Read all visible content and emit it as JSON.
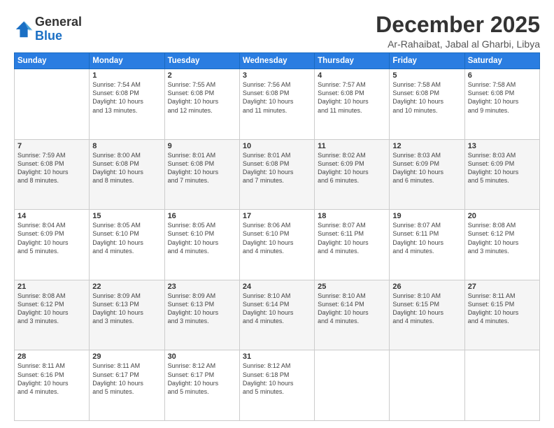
{
  "logo": {
    "general": "General",
    "blue": "Blue"
  },
  "title": "December 2025",
  "subtitle": "Ar-Rahaibat, Jabal al Gharbi, Libya",
  "weekdays": [
    "Sunday",
    "Monday",
    "Tuesday",
    "Wednesday",
    "Thursday",
    "Friday",
    "Saturday"
  ],
  "weeks": [
    [
      {
        "day": "",
        "info": ""
      },
      {
        "day": "1",
        "info": "Sunrise: 7:54 AM\nSunset: 6:08 PM\nDaylight: 10 hours\nand 13 minutes."
      },
      {
        "day": "2",
        "info": "Sunrise: 7:55 AM\nSunset: 6:08 PM\nDaylight: 10 hours\nand 12 minutes."
      },
      {
        "day": "3",
        "info": "Sunrise: 7:56 AM\nSunset: 6:08 PM\nDaylight: 10 hours\nand 11 minutes."
      },
      {
        "day": "4",
        "info": "Sunrise: 7:57 AM\nSunset: 6:08 PM\nDaylight: 10 hours\nand 11 minutes."
      },
      {
        "day": "5",
        "info": "Sunrise: 7:58 AM\nSunset: 6:08 PM\nDaylight: 10 hours\nand 10 minutes."
      },
      {
        "day": "6",
        "info": "Sunrise: 7:58 AM\nSunset: 6:08 PM\nDaylight: 10 hours\nand 9 minutes."
      }
    ],
    [
      {
        "day": "7",
        "info": "Sunrise: 7:59 AM\nSunset: 6:08 PM\nDaylight: 10 hours\nand 8 minutes."
      },
      {
        "day": "8",
        "info": "Sunrise: 8:00 AM\nSunset: 6:08 PM\nDaylight: 10 hours\nand 8 minutes."
      },
      {
        "day": "9",
        "info": "Sunrise: 8:01 AM\nSunset: 6:08 PM\nDaylight: 10 hours\nand 7 minutes."
      },
      {
        "day": "10",
        "info": "Sunrise: 8:01 AM\nSunset: 6:08 PM\nDaylight: 10 hours\nand 7 minutes."
      },
      {
        "day": "11",
        "info": "Sunrise: 8:02 AM\nSunset: 6:09 PM\nDaylight: 10 hours\nand 6 minutes."
      },
      {
        "day": "12",
        "info": "Sunrise: 8:03 AM\nSunset: 6:09 PM\nDaylight: 10 hours\nand 6 minutes."
      },
      {
        "day": "13",
        "info": "Sunrise: 8:03 AM\nSunset: 6:09 PM\nDaylight: 10 hours\nand 5 minutes."
      }
    ],
    [
      {
        "day": "14",
        "info": "Sunrise: 8:04 AM\nSunset: 6:09 PM\nDaylight: 10 hours\nand 5 minutes."
      },
      {
        "day": "15",
        "info": "Sunrise: 8:05 AM\nSunset: 6:10 PM\nDaylight: 10 hours\nand 4 minutes."
      },
      {
        "day": "16",
        "info": "Sunrise: 8:05 AM\nSunset: 6:10 PM\nDaylight: 10 hours\nand 4 minutes."
      },
      {
        "day": "17",
        "info": "Sunrise: 8:06 AM\nSunset: 6:10 PM\nDaylight: 10 hours\nand 4 minutes."
      },
      {
        "day": "18",
        "info": "Sunrise: 8:07 AM\nSunset: 6:11 PM\nDaylight: 10 hours\nand 4 minutes."
      },
      {
        "day": "19",
        "info": "Sunrise: 8:07 AM\nSunset: 6:11 PM\nDaylight: 10 hours\nand 4 minutes."
      },
      {
        "day": "20",
        "info": "Sunrise: 8:08 AM\nSunset: 6:12 PM\nDaylight: 10 hours\nand 3 minutes."
      }
    ],
    [
      {
        "day": "21",
        "info": "Sunrise: 8:08 AM\nSunset: 6:12 PM\nDaylight: 10 hours\nand 3 minutes."
      },
      {
        "day": "22",
        "info": "Sunrise: 8:09 AM\nSunset: 6:13 PM\nDaylight: 10 hours\nand 3 minutes."
      },
      {
        "day": "23",
        "info": "Sunrise: 8:09 AM\nSunset: 6:13 PM\nDaylight: 10 hours\nand 3 minutes."
      },
      {
        "day": "24",
        "info": "Sunrise: 8:10 AM\nSunset: 6:14 PM\nDaylight: 10 hours\nand 4 minutes."
      },
      {
        "day": "25",
        "info": "Sunrise: 8:10 AM\nSunset: 6:14 PM\nDaylight: 10 hours\nand 4 minutes."
      },
      {
        "day": "26",
        "info": "Sunrise: 8:10 AM\nSunset: 6:15 PM\nDaylight: 10 hours\nand 4 minutes."
      },
      {
        "day": "27",
        "info": "Sunrise: 8:11 AM\nSunset: 6:15 PM\nDaylight: 10 hours\nand 4 minutes."
      }
    ],
    [
      {
        "day": "28",
        "info": "Sunrise: 8:11 AM\nSunset: 6:16 PM\nDaylight: 10 hours\nand 4 minutes."
      },
      {
        "day": "29",
        "info": "Sunrise: 8:11 AM\nSunset: 6:17 PM\nDaylight: 10 hours\nand 5 minutes."
      },
      {
        "day": "30",
        "info": "Sunrise: 8:12 AM\nSunset: 6:17 PM\nDaylight: 10 hours\nand 5 minutes."
      },
      {
        "day": "31",
        "info": "Sunrise: 8:12 AM\nSunset: 6:18 PM\nDaylight: 10 hours\nand 5 minutes."
      },
      {
        "day": "",
        "info": ""
      },
      {
        "day": "",
        "info": ""
      },
      {
        "day": "",
        "info": ""
      }
    ]
  ]
}
